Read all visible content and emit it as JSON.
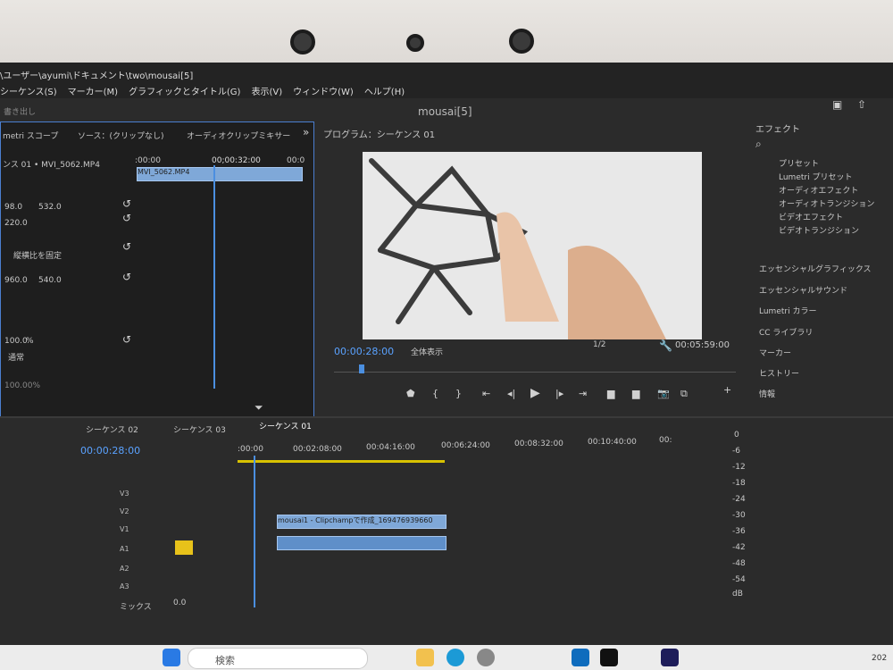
{
  "window": {
    "path": "\\ユーザー\\ayumi\\ドキュメント\\two\\mousai[5]",
    "title": "mousai[5]",
    "menu": [
      "シーケンス(S)",
      "マーカー(M)",
      "グラフィックとタイトル(G)",
      "表示(V)",
      "ウィンドウ(W)",
      "ヘルプ(H)"
    ],
    "export": "書き出し"
  },
  "source_panel": {
    "tabs": [
      "metri スコープ",
      "ソース：(クリップなし)",
      "オーディオクリップミキサー"
    ],
    "clip": "ンス 01 • MVI_5062.MP4",
    "timecode": "00;00:32:00",
    "ruler_start": ":00:00",
    "ruler_end": "00:0",
    "clip_label": "MVI_5062.MP4",
    "values": [
      "98.0",
      "532.0",
      "220.0",
      "960.0",
      "540.0",
      "100.0",
      "%"
    ],
    "aspect_label": "縦横比を固定",
    "blend": "通常",
    "zoom": "100.00%"
  },
  "program": {
    "title": "プログラム：シーケンス 01",
    "timecode": "00:00:28:00",
    "fit": "全体表示",
    "resolution": "1/2",
    "duration": "00:05:59:00"
  },
  "effects": {
    "title": "エフェクト",
    "items": [
      "プリセット",
      "Lumetri プリセット",
      "オーディオエフェクト",
      "オーディオトランジション",
      "ビデオエフェクト",
      "ビデオトランジション"
    ],
    "panels": [
      "エッセンシャルグラフィックス",
      "エッセンシャルサウンド",
      "Lumetri カラー",
      "CC ライブラリ",
      "マーカー",
      "ヒストリー",
      "情報"
    ]
  },
  "timeline": {
    "tabs": [
      "シーケンス 02",
      "シーケンス 03",
      "シーケンス 01"
    ],
    "timecode": "00:00:28:00",
    "ruler": [
      ":00:00",
      "00:02:08:00",
      "00:04:16:00",
      "00:06:24:00",
      "00:08:32:00",
      "00:10:40:00",
      "00:"
    ],
    "tracks": [
      "V3",
      "V2",
      "V1",
      "A1",
      "A2",
      "A3"
    ],
    "mix_label": "ミックス",
    "mix_value": "0.0",
    "clip_v": "mousai1 - Clipchampで作成_169476939660",
    "meter": [
      "0",
      "-6",
      "-12",
      "-18",
      "-24",
      "-30",
      "-36",
      "-42",
      "-48",
      "-54",
      "dB"
    ]
  },
  "taskbar": {
    "search_placeholder": "検索",
    "clock": "202"
  },
  "colors": {
    "accent": "#5aa2ff",
    "clip_video": "#7fa8d8",
    "solo": "#e8c21a",
    "work_area": "#d8c200"
  }
}
